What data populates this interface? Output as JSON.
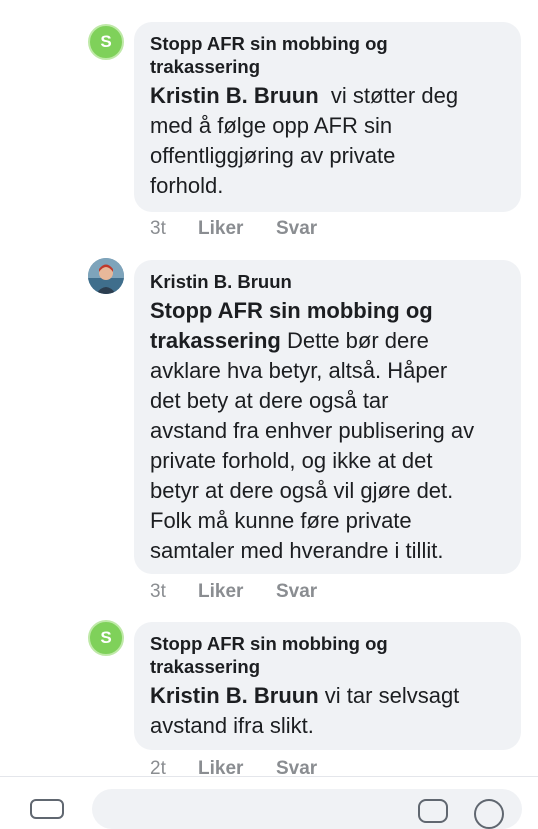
{
  "comments": [
    {
      "avatar_letter": "S",
      "author": "Stopp AFR sin mobbing og trakassering",
      "author_line1": "Stopp AFR sin mobbing og",
      "author_line2": "trakassering",
      "mention": "Kristin B. Bruun",
      "text_lines": [
        "vi støtter deg",
        "med å følge opp AFR sin",
        "offentliggjøring av private",
        "forhold."
      ],
      "time": "3t",
      "like_label": "Liker",
      "reply_label": "Svar"
    },
    {
      "avatar_letter": "",
      "author": "Kristin B. Bruun",
      "mention_line1": "Stopp AFR sin mobbing og",
      "mention_line2": "trakassering",
      "text_lines": [
        "Dette bør dere",
        "avklare hva betyr, altså. Håper",
        "det bety at dere også  tar",
        "avstand fra enhver publisering av",
        "private forhold, og ikke at det",
        "betyr at dere også vil gjøre det.",
        "Folk må kunne føre private",
        "samtaler med hverandre i tillit."
      ],
      "time": "3t",
      "like_label": "Liker",
      "reply_label": "Svar"
    },
    {
      "avatar_letter": "S",
      "author_line1": "Stopp AFR sin mobbing og",
      "author_line2": "trakassering",
      "mention": "Kristin B. Bruun",
      "text_lines": [
        "vi tar selvsagt",
        "avstand ifra slikt."
      ],
      "time": "2t",
      "like_label": "Liker",
      "reply_label": "Svar"
    }
  ],
  "colors": {
    "bubble": "#f0f2f5",
    "avatar_green": "#7fd15a",
    "muted_text": "#8a8d91"
  },
  "icons": {
    "composer_left": "camera-icon",
    "composer_right_1": "gif-icon",
    "composer_right_2": "emoji-icon"
  }
}
